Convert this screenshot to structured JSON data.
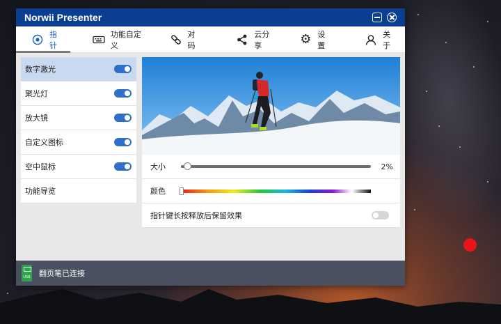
{
  "window": {
    "title": "Norwii Presenter"
  },
  "tabs": [
    {
      "label": "指针",
      "icon": "target-icon"
    },
    {
      "label": "功能自定义",
      "icon": "keyboard-icon"
    },
    {
      "label": "对码",
      "icon": "link-icon"
    },
    {
      "label": "云分享",
      "icon": "share-icon"
    },
    {
      "label": "设置",
      "icon": "gear-icon"
    },
    {
      "label": "关于",
      "icon": "user-icon"
    }
  ],
  "sidebar": {
    "items": [
      {
        "label": "数字激光",
        "enabled": true
      },
      {
        "label": "聚光灯",
        "enabled": true
      },
      {
        "label": "放大镜",
        "enabled": true
      },
      {
        "label": "自定义图标",
        "enabled": true
      },
      {
        "label": "空中鼠标",
        "enabled": true
      },
      {
        "label": "功能导览"
      }
    ]
  },
  "settings": {
    "size_label": "大小",
    "size_value": "2%",
    "color_label": "颜色",
    "selected_color": "#e81818",
    "keep_effect_label": "指针键长按释放后保留效果",
    "keep_effect_enabled": false
  },
  "status": {
    "text": "翻页笔已连接",
    "usb_label": "USB"
  },
  "colors": {
    "titlebar": "#0b3d91",
    "accent": "#2f6fc7",
    "status_bar": "#4a5060"
  }
}
